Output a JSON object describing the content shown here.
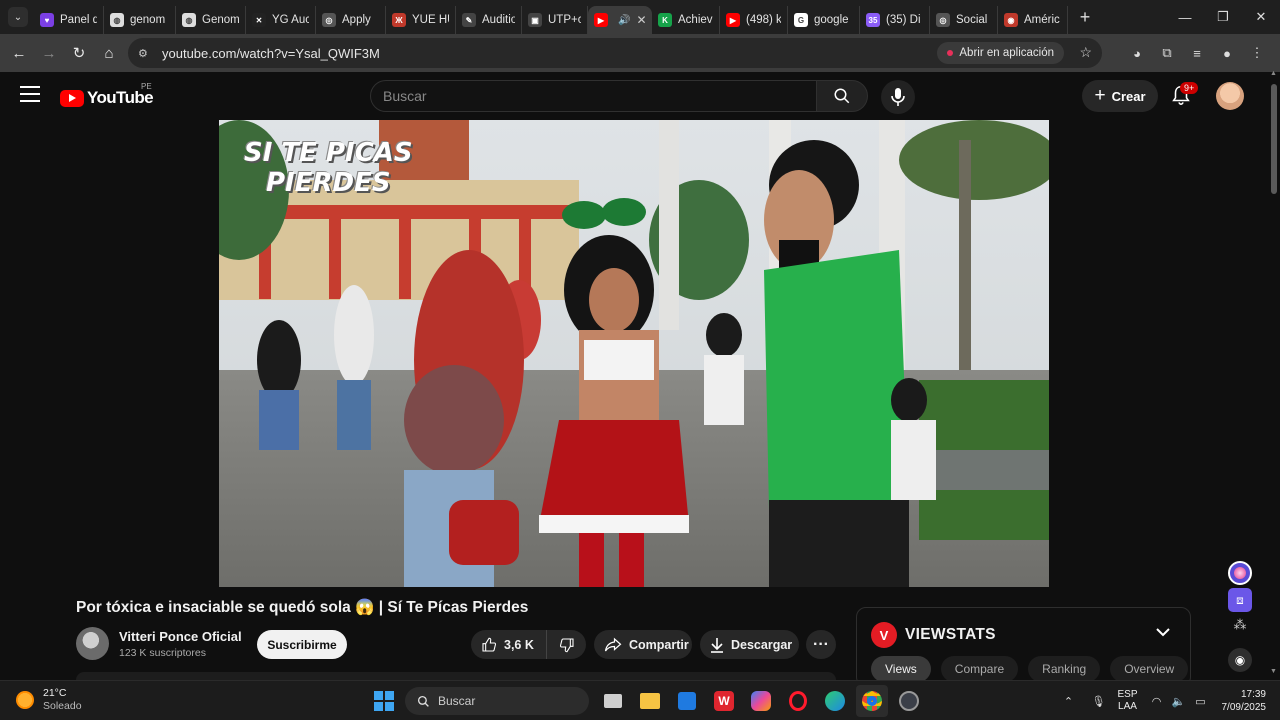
{
  "browser": {
    "tabs": [
      {
        "title": "Panel d",
        "icon": "purple-heart-icon",
        "color": "#7b3fe4",
        "glyph": "♥"
      },
      {
        "title": "genom",
        "icon": "generic-site-icon",
        "color": "#dddddd",
        "glyph": "◍"
      },
      {
        "title": "Genom",
        "icon": "generic-site-icon",
        "color": "#dddddd",
        "glyph": "◍"
      },
      {
        "title": "YG Auc",
        "icon": "yg-icon",
        "color": "#222222",
        "glyph": "✕"
      },
      {
        "title": "Apply",
        "icon": "globe-icon",
        "color": "#555555",
        "glyph": "◎"
      },
      {
        "title": "YUE HU",
        "icon": "yue-hu-icon",
        "color": "#c0392b",
        "glyph": "Ж"
      },
      {
        "title": "Auditio",
        "icon": "pen-icon",
        "color": "#444444",
        "glyph": "✎"
      },
      {
        "title": "UTP+cl",
        "icon": "utp-icon",
        "color": "#444444",
        "glyph": "▣"
      },
      {
        "title": "",
        "icon": "youtube-icon",
        "color": "#ff0000",
        "glyph": "▶",
        "active": true
      },
      {
        "title": "Achiev",
        "icon": "achieve-icon",
        "color": "#16a34a",
        "glyph": "K"
      },
      {
        "title": "(498) k",
        "icon": "youtube-icon",
        "color": "#ff0000",
        "glyph": "▶"
      },
      {
        "title": "google",
        "icon": "google-icon",
        "color": "#ffffff",
        "glyph": "G"
      },
      {
        "title": "(35) Di",
        "icon": "discord-icon",
        "color": "#8b5cf6",
        "glyph": "35"
      },
      {
        "title": "Social",
        "icon": "globe-icon",
        "color": "#555555",
        "glyph": "◎"
      },
      {
        "title": "Améric",
        "icon": "america-icon",
        "color": "#c0392b",
        "glyph": "◉"
      }
    ],
    "url": "youtube.com/watch?v=Ysal_QWIF3M",
    "open_in_app": "Abrir en aplicación"
  },
  "youtube": {
    "logo_text": "YouTube",
    "country": "PE",
    "search_placeholder": "Buscar",
    "create_label": "Crear",
    "notifications": "9+"
  },
  "video": {
    "overlay_line1": "SI TE PICAS",
    "overlay_line2": "PIERDES",
    "title": "Por tóxica e insaciable se quedó sola 😱 | Sí Te Pícas Pierdes",
    "channel": "Vitteri Ponce Oficial",
    "subscribers": "123 K suscriptores",
    "subscribe_label": "Suscribirme",
    "likes": "3,6 K",
    "share_label": "Compartir",
    "download_label": "Descargar",
    "more_label": "···"
  },
  "viewstats": {
    "name": "VIEWSTATS",
    "logo_letter": "V",
    "tabs": [
      "Views",
      "Compare",
      "Ranking",
      "Overview"
    ],
    "active_tab": "Views",
    "brand_color": "#e41c24"
  },
  "taskbar": {
    "temperature": "21°C",
    "weather": "Soleado",
    "search_placeholder": "Buscar",
    "lang_line1": "ESP",
    "lang_line2": "LAA",
    "time": "17:39",
    "date": "7/09/2025"
  }
}
